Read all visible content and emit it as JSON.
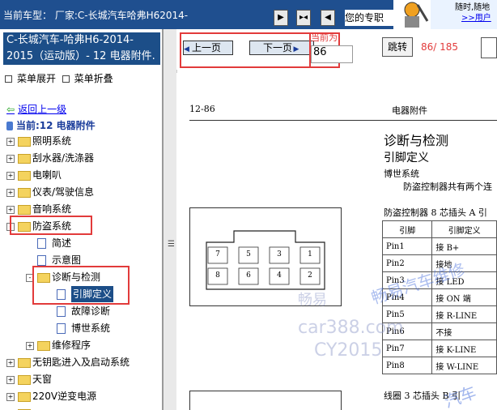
{
  "topbar": {
    "vehicle": "当前车型：  厂家:C-长城汽车哈弗H62014-",
    "pro_text": "您的专职",
    "slogan_line1": "随时,随地",
    "slogan_link": ">>用户"
  },
  "left": {
    "book_title": "C-长城汽车-哈弗H6-2014-2015（运动版）- 12 电器附件.",
    "book_title_tail": "2015（运动版",
    "menu_expand": "菜单展开",
    "menu_collapse": "菜单折叠",
    "back": "返回上一级",
    "current": "当前:12 电器附件",
    "tree": [
      {
        "label": "照明系统",
        "level": 0,
        "type": "folder",
        "pm": "+"
      },
      {
        "label": "刮水器/洗涤器",
        "level": 0,
        "type": "folder",
        "pm": "+"
      },
      {
        "label": "电喇叭",
        "level": 0,
        "type": "folder",
        "pm": "+"
      },
      {
        "label": "仪表/驾驶信息",
        "level": 0,
        "type": "folder",
        "pm": "+"
      },
      {
        "label": "音响系统",
        "level": 0,
        "type": "folder",
        "pm": "+"
      },
      {
        "label": "防盗系统",
        "level": 0,
        "type": "folder",
        "pm": "-"
      },
      {
        "label": "简述",
        "level": 1,
        "type": "doc",
        "pm": ""
      },
      {
        "label": "示意图",
        "level": 1,
        "type": "doc",
        "pm": ""
      },
      {
        "label": "诊断与检测",
        "level": 1,
        "type": "folder",
        "pm": "-"
      },
      {
        "label": "引脚定义",
        "level": 2,
        "type": "doc",
        "pm": "",
        "selected": true
      },
      {
        "label": "故障诊断",
        "level": 2,
        "type": "doc",
        "pm": ""
      },
      {
        "label": "博世系统",
        "level": 2,
        "type": "doc",
        "pm": ""
      },
      {
        "label": "维修程序",
        "level": 1,
        "type": "folder",
        "pm": "+"
      },
      {
        "label": "无钥匙进入及启动系统",
        "level": 0,
        "type": "folder",
        "pm": "+"
      },
      {
        "label": "天窗",
        "level": 0,
        "type": "folder",
        "pm": "+"
      },
      {
        "label": "220V逆变电源",
        "level": 0,
        "type": "folder",
        "pm": "+"
      },
      {
        "label": "",
        "level": 0,
        "type": "folder",
        "pm": "+"
      }
    ]
  },
  "toolbar": {
    "prev": "上一页",
    "next": "下一页",
    "current_label": "当前为",
    "current_page": "86",
    "jump": "跳转",
    "page_count": "86/ 185"
  },
  "doc": {
    "page_num": "12-86",
    "section": "电器附件",
    "title": "诊断与检测",
    "subtitle": "引脚定义",
    "system": "博世系统",
    "desc": "防盗控制器共有两个连",
    "table_caption": "防盗控制器 8 芯插头 A 引",
    "table_header": [
      "引脚",
      "引脚定义"
    ],
    "pins": [
      [
        "Pin1",
        "接 B+"
      ],
      [
        "Pin2",
        "接地"
      ],
      [
        "Pin3",
        "接 LED"
      ],
      [
        "Pin4",
        "接 ON 端"
      ],
      [
        "Pin5",
        "接 R-LINE"
      ],
      [
        "Pin6",
        "不接"
      ],
      [
        "Pin7",
        "接 K-LINE"
      ],
      [
        "Pin8",
        "接 W-LINE"
      ]
    ],
    "connector_top": [
      "7",
      "5",
      "3",
      "1"
    ],
    "connector_bottom": [
      "8",
      "6",
      "4",
      "2"
    ],
    "coil_caption": "线圈 3 芯插头 B 引",
    "watermarks": [
      "畅易",
      "畅易汽车维修",
      "car388.com",
      "CY2015",
      "汽车"
    ]
  }
}
